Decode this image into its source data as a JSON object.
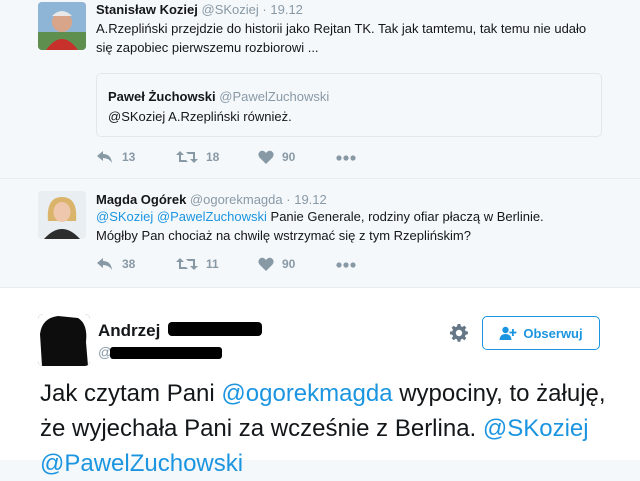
{
  "tweets": [
    {
      "name": "Stanisław Koziej",
      "handle": "@SKoziej",
      "sep": "·",
      "time": "19.12",
      "text": "A.Rzepliński przejdzie do historii jako Rejtan TK. Tak jak tamtemu, tak temu nie udało się zapobiec pierwszemu rozbiorowi ...",
      "quote": {
        "name": "Paweł Żuchowski",
        "handle": "@PawelZuchowski",
        "text": "@SKoziej A.Rzepliński również."
      },
      "actions": {
        "reply": "13",
        "retweet": "18",
        "like": "90"
      }
    },
    {
      "name": "Magda Ogórek",
      "handle": "@ogorekmagda",
      "sep": "·",
      "time": "19.12",
      "mention1": "@SKoziej",
      "mention2": "@PawelZuchowski",
      "text_line1": " Panie Generale, rodziny ofiar płaczą w Berlinie.",
      "text_line2": "Mógłby Pan chociaż na chwilę wstrzymać się z tym Rzeplińskim?",
      "actions": {
        "reply": "38",
        "retweet": "11",
        "like": "90"
      }
    }
  ],
  "main_tweet": {
    "name": "Andrzej",
    "handle_prefix": "@",
    "follow_label": "Obserwuj",
    "text_part1": "Jak czytam Pani ",
    "mention": "@ogorekmagda",
    "text_part2": " wypociny, to żałuję, że wyjechała Pani za wcześnie z Berlina. ",
    "mention2": "@SKoziej",
    "mention3": "@PawelZuchowski"
  },
  "colors": {
    "link": "#1b95e0",
    "meta": "#8899a6",
    "text": "#14171a",
    "bg": "#f5f8fa"
  },
  "icons": [
    "reply-icon",
    "retweet-icon",
    "like-icon",
    "more-icon",
    "gear-icon",
    "follow-user-icon"
  ]
}
